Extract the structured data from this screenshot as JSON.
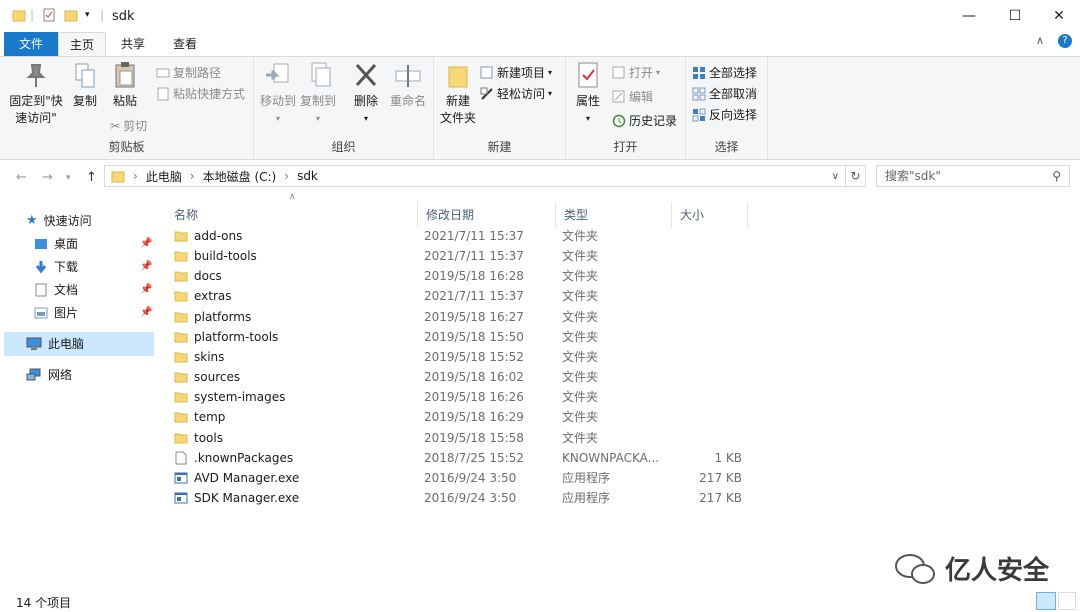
{
  "window": {
    "title": "sdk",
    "minimize": "—",
    "maximize": "☐",
    "close": "✕"
  },
  "tabs": [
    {
      "label": "文件"
    },
    {
      "label": "主页"
    },
    {
      "label": "共享"
    },
    {
      "label": "查看"
    }
  ],
  "ribbon": {
    "clipboard": {
      "pin": "固定到\"快",
      "pin2": "速访问\"",
      "copy": "复制",
      "paste": "粘贴",
      "copy_path": "复制路径",
      "paste_shortcut": "粘贴快捷方式",
      "cut": "剪切",
      "label": "剪贴板"
    },
    "organize": {
      "move_to": "移动到",
      "copy_to": "复制到",
      "delete": "删除",
      "rename": "重命名",
      "label": "组织"
    },
    "new": {
      "new_folder": "新建",
      "new_folder2": "文件夹",
      "new_item": "新建项目",
      "easy_access": "轻松访问",
      "label": "新建"
    },
    "open": {
      "properties": "属性",
      "open": "打开",
      "edit": "编辑",
      "history": "历史记录",
      "label": "打开"
    },
    "select": {
      "select_all": "全部选择",
      "select_none": "全部取消",
      "invert": "反向选择",
      "label": "选择"
    }
  },
  "address": {
    "crumbs": [
      "此电脑",
      "本地磁盘 (C:)",
      "sdk"
    ],
    "search_placeholder": "搜索\"sdk\""
  },
  "nav": {
    "quick_access": "快速访问",
    "desktop": "桌面",
    "downloads": "下载",
    "documents": "文档",
    "pictures": "图片",
    "this_pc": "此电脑",
    "network": "网络"
  },
  "columns": {
    "name": "名称",
    "date": "修改日期",
    "type": "类型",
    "size": "大小"
  },
  "files": [
    {
      "name": "add-ons",
      "date": "2021/7/11 15:37",
      "type": "文件夹",
      "size": "",
      "kind": "folder"
    },
    {
      "name": "build-tools",
      "date": "2021/7/11 15:37",
      "type": "文件夹",
      "size": "",
      "kind": "folder"
    },
    {
      "name": "docs",
      "date": "2019/5/18 16:28",
      "type": "文件夹",
      "size": "",
      "kind": "folder"
    },
    {
      "name": "extras",
      "date": "2021/7/11 15:37",
      "type": "文件夹",
      "size": "",
      "kind": "folder"
    },
    {
      "name": "platforms",
      "date": "2019/5/18 16:27",
      "type": "文件夹",
      "size": "",
      "kind": "folder"
    },
    {
      "name": "platform-tools",
      "date": "2019/5/18 15:50",
      "type": "文件夹",
      "size": "",
      "kind": "folder"
    },
    {
      "name": "skins",
      "date": "2019/5/18 15:52",
      "type": "文件夹",
      "size": "",
      "kind": "folder"
    },
    {
      "name": "sources",
      "date": "2019/5/18 16:02",
      "type": "文件夹",
      "size": "",
      "kind": "folder"
    },
    {
      "name": "system-images",
      "date": "2019/5/18 16:26",
      "type": "文件夹",
      "size": "",
      "kind": "folder"
    },
    {
      "name": "temp",
      "date": "2019/5/18 16:29",
      "type": "文件夹",
      "size": "",
      "kind": "folder"
    },
    {
      "name": "tools",
      "date": "2019/5/18 15:58",
      "type": "文件夹",
      "size": "",
      "kind": "folder"
    },
    {
      "name": ".knownPackages",
      "date": "2018/7/25 15:52",
      "type": "KNOWNPACKA...",
      "size": "1 KB",
      "kind": "file"
    },
    {
      "name": "AVD Manager.exe",
      "date": "2016/9/24 3:50",
      "type": "应用程序",
      "size": "217 KB",
      "kind": "exe"
    },
    {
      "name": "SDK Manager.exe",
      "date": "2016/9/24 3:50",
      "type": "应用程序",
      "size": "217 KB",
      "kind": "exe"
    }
  ],
  "status": {
    "count": "14 个项目"
  },
  "watermark": {
    "text": "亿人安全"
  },
  "colors": {
    "accent": "#1979ca",
    "folder": "#f8d775"
  }
}
